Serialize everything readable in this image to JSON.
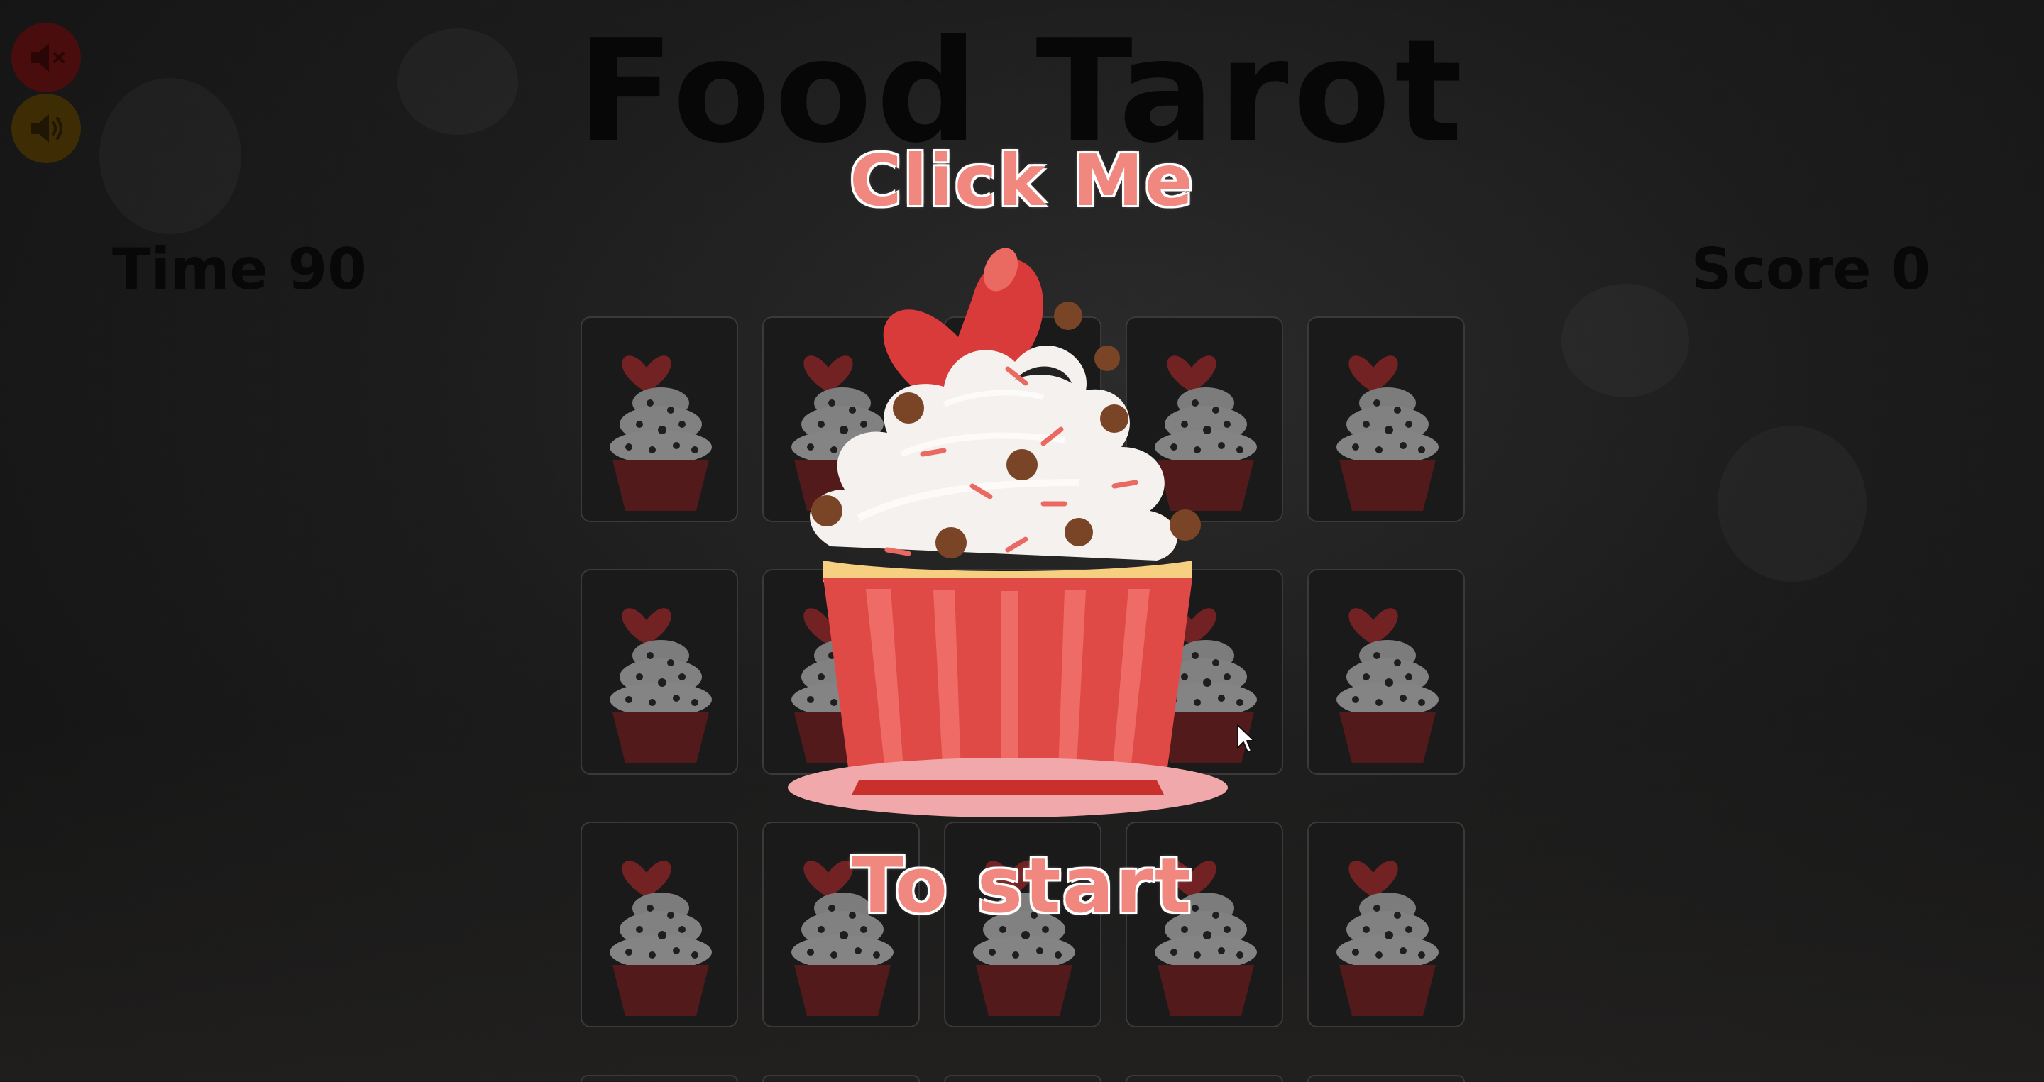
{
  "game": {
    "title": "Food Tarot",
    "time_label": "Time 90",
    "score_label": "Score 0"
  },
  "overlay": {
    "top_text": "Click Me",
    "bottom_text": "To start"
  },
  "audio": {
    "mute_icon": "speaker-mute-icon",
    "sound_icon": "speaker-sound-icon"
  },
  "cards": {
    "rows": 3,
    "columns": 5,
    "back_icon": "cupcake-icon"
  },
  "colors": {
    "accent_text": "#f08880",
    "frosting": "#f4f1ee",
    "cup": "#e04a46",
    "heart": "#d93a3a"
  }
}
